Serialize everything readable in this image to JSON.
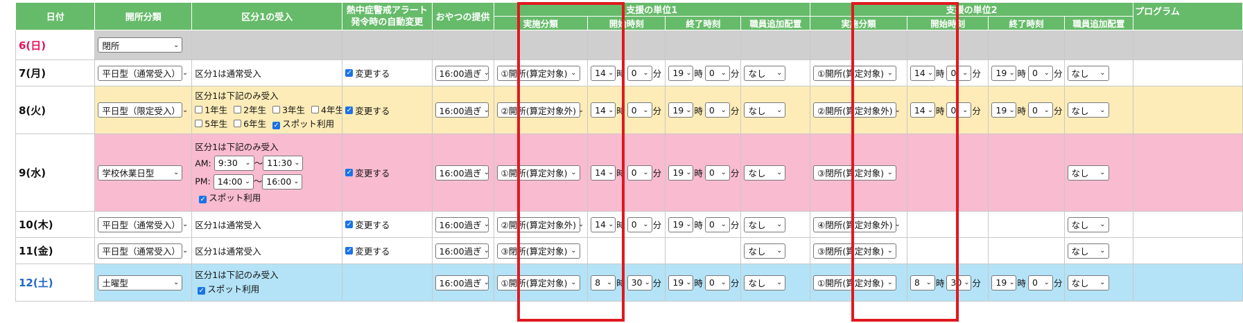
{
  "headers": {
    "date": "日付",
    "open_type": "開所分類",
    "kubun": "区分1の受入",
    "heat_line1": "熱中症警戒アラート",
    "heat_line2": "発令時の自動変更",
    "snack": "おやつの提供",
    "unit1": "支援の単位1",
    "unit2": "支援の単位2",
    "program": "プログラム",
    "impl": "実施分類",
    "start": "開始時刻",
    "end": "終了時刻",
    "staff": "職員追加配置"
  },
  "units": {
    "hour": "時",
    "minute": "分",
    "tilde": "〜",
    "am": "AM:",
    "pm": "PM:"
  },
  "rows": [
    {
      "date": "6(日)",
      "open": "閉所"
    },
    {
      "date": "7(月)",
      "open": "平日型（通常受入）",
      "kubun": "区分1は通常受入",
      "heat": "変更する",
      "snack": "16:00過ぎ",
      "u1": {
        "impl": "①開所(算定対象)",
        "sh": "14",
        "sm": "0",
        "eh": "19",
        "em": "0",
        "staff": "なし"
      },
      "u2": {
        "impl": "①開所(算定対象)",
        "sh": "14",
        "sm": "0",
        "eh": "19",
        "em": "0",
        "staff": "なし"
      }
    },
    {
      "date": "8(火)",
      "open": "平日型（限定受入）",
      "kubun": "区分1は下記のみ受入",
      "grades": [
        "1年生",
        "2年生",
        "3年生",
        "4年生",
        "5年生",
        "6年生"
      ],
      "spot": "スポット利用",
      "heat": "変更する",
      "snack": "16:00過ぎ",
      "u1": {
        "impl": "②開所(算定対象外)",
        "sh": "14",
        "sm": "0",
        "eh": "19",
        "em": "0",
        "staff": "なし"
      },
      "u2": {
        "impl": "②開所(算定対象外)",
        "sh": "14",
        "sm": "0",
        "eh": "19",
        "em": "0",
        "staff": "なし"
      }
    },
    {
      "date": "9(水)",
      "open": "学校休業日型",
      "kubun": "区分1は下記のみ受入",
      "am_from": "9:30",
      "am_to": "11:30",
      "pm_from": "14:00",
      "pm_to": "16:00",
      "spot": "スポット利用",
      "heat": "変更する",
      "snack": "16:00過ぎ",
      "u1": {
        "impl": "①開所(算定対象)",
        "sh": "14",
        "sm": "0",
        "eh": "19",
        "em": "0",
        "staff": "なし"
      },
      "u2": {
        "impl": "③閉所(算定対象)",
        "staff": "なし"
      }
    },
    {
      "date": "10(木)",
      "open": "平日型（通常受入）",
      "kubun": "区分1は通常受入",
      "heat": "変更する",
      "snack": "16:00過ぎ",
      "u1": {
        "impl": "②開所(算定対象外)",
        "sh": "14",
        "sm": "0",
        "eh": "19",
        "em": "0",
        "staff": "なし"
      },
      "u2": {
        "impl": "④閉所(算定対象外)",
        "staff": "なし"
      }
    },
    {
      "date": "11(金)",
      "open": "平日型（通常受入）",
      "kubun": "区分1は通常受入",
      "heat": "変更する",
      "snack": "16:00過ぎ",
      "u1": {
        "impl": "③閉所(算定対象)",
        "staff": "なし"
      },
      "u2": {
        "impl": "③閉所(算定対象)",
        "staff": "なし"
      }
    },
    {
      "date": "12(土)",
      "open": "土曜型",
      "kubun": "区分1は下記のみ受入",
      "spot": "スポット利用",
      "snack": "16:00過ぎ",
      "u1": {
        "impl": "①開所(算定対象)",
        "sh": "8",
        "sm": "30",
        "eh": "19",
        "em": "0",
        "staff": "なし"
      },
      "u2": {
        "impl": "①開所(算定対象)",
        "sh": "8",
        "sm": "30",
        "eh": "19",
        "em": "0",
        "staff": "なし"
      }
    }
  ],
  "colors": {
    "header": "#66bb6a",
    "sunday": "#e5125f",
    "saturday": "#1e66c8",
    "highlight": "#e0181f",
    "checkbox": "#1a73e8"
  }
}
